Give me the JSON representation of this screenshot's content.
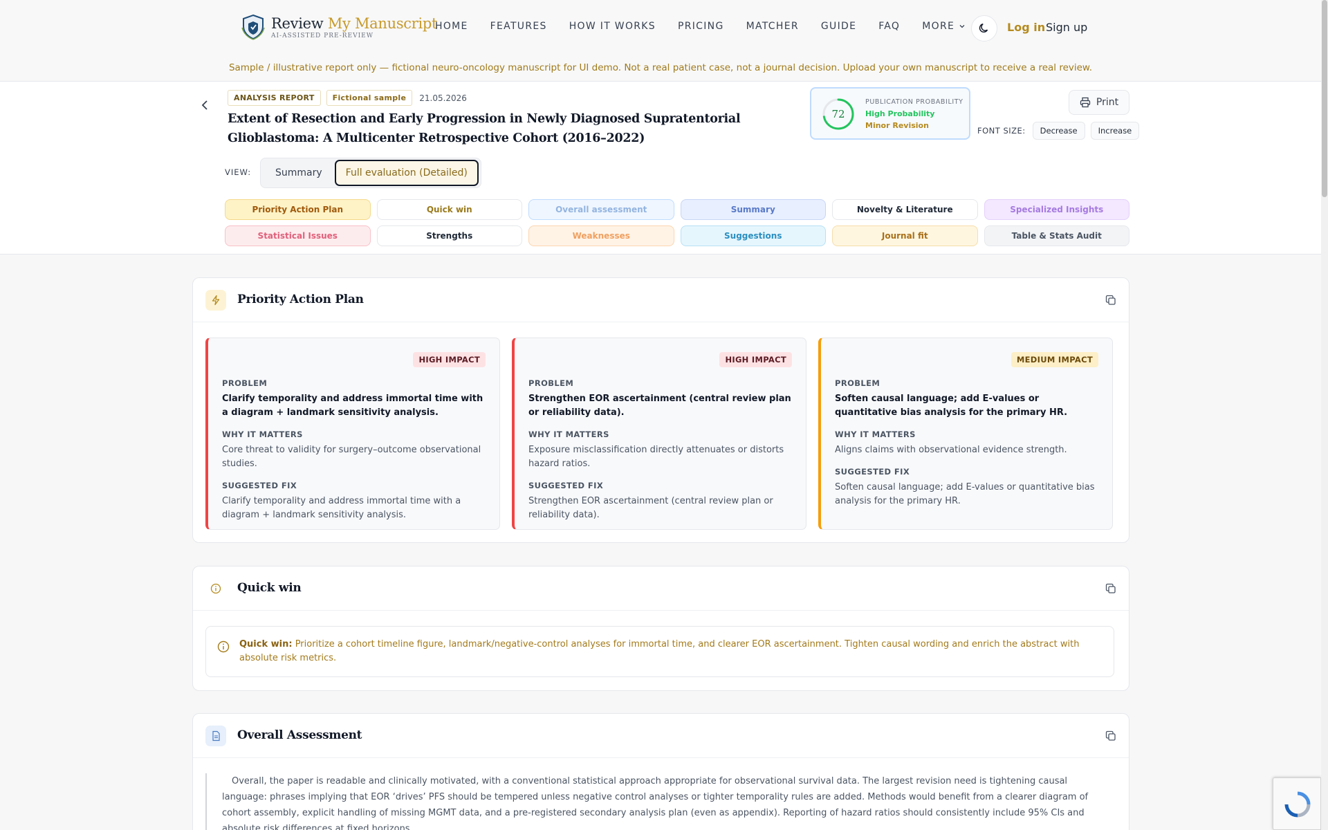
{
  "header": {
    "brand_part1": "Review ",
    "brand_part2": "My Manuscript",
    "tagline": "AI-ASSISTED PRE-REVIEW",
    "nav": [
      "HOME",
      "FEATURES",
      "HOW IT WORKS",
      "PRICING",
      "MATCHER",
      "GUIDE",
      "FAQ"
    ],
    "nav_more": "MORE",
    "login": "Log in",
    "signup": "Sign up",
    "notice": "Sample / illustrative report only — fictional neuro-oncology manuscript for UI demo. Not a real patient case, not a journal decision. Upload your own manuscript to receive a real review."
  },
  "report": {
    "tag_type": "ANALYSIS REPORT",
    "tag_sample": "Fictional sample",
    "date": "21.05.2026",
    "title": "Extent of Resection and Early Progression in Newly Diagnosed Supratentorial Glioblastoma: A Multicenter Retrospective Cohort (2016–2022)",
    "probability": {
      "score": "72",
      "score_fraction": 0.72,
      "label": "PUBLICATION PROBABILITY",
      "level": "High Probability",
      "decision": "Minor Revision"
    },
    "print_label": "Print",
    "font_size_label": "FONT SIZE:",
    "decrease": "Decrease",
    "increase": "Increase",
    "view_label": "VIEW:",
    "view_summary": "Summary",
    "view_full": "Full evaluation (Detailed)",
    "chips": [
      "Priority Action Plan",
      "Quick win",
      "Overall assessment",
      "Summary",
      "Novelty & Literature",
      "Specialized Insights",
      "Statistical Issues",
      "Strengths",
      "Weaknesses",
      "Suggestions",
      "Journal fit",
      "Table & Stats Audit"
    ]
  },
  "priority": {
    "title": "Priority Action Plan",
    "problem_label": "PROBLEM",
    "why_label": "WHY IT MATTERS",
    "fix_label": "SUGGESTED FIX",
    "actions": [
      {
        "impact": "HIGH IMPACT",
        "problem": "Clarify temporality and address immortal time with a diagram + landmark sensitivity analysis.",
        "why": "Core threat to validity for surgery–outcome observational studies.",
        "fix": "Clarify temporality and address immortal time with a diagram + landmark sensitivity analysis."
      },
      {
        "impact": "HIGH IMPACT",
        "problem": "Strengthen EOR ascertainment (central review plan or reliability data).",
        "why": "Exposure misclassification directly attenuates or distorts hazard ratios.",
        "fix": "Strengthen EOR ascertainment (central review plan or reliability data)."
      },
      {
        "impact": "MEDIUM IMPACT",
        "problem": "Soften causal language; add E-values or quantitative bias analysis for the primary HR.",
        "why": "Aligns claims with observational evidence strength.",
        "fix": "Soften causal language; add E-values or quantitative bias analysis for the primary HR."
      }
    ]
  },
  "quick_win": {
    "title": "Quick win",
    "label": "Quick win:",
    "text": " Prioritize a cohort timeline figure, landmark/negative-control analyses for immortal time, and clearer EOR ascertainment. Tighten causal wording and enrich the abstract with absolute risk metrics."
  },
  "overall": {
    "title": "Overall Assessment",
    "text": "Overall, the paper is readable and clinically motivated, with a conventional statistical approach appropriate for observational survival data. The largest revision need is tightening causal language: phrases implying that EOR ‘drives’ PFS should be tempered unless negative control analyses or tighter temporality rules are added. Methods would benefit from a clearer diagram of cohort assembly, explicit handling of missing MGMT data, and a pre-registered secondary analysis plan (even as appendix). Reporting of hazard ratios should consistently include 95% CIs and absolute risk differences at fixed horizons."
  },
  "colors": {
    "accent": "#c79a2b",
    "high_impact": "#ef4444",
    "medium_impact": "#f59e0b",
    "probability": "#22c55e"
  }
}
